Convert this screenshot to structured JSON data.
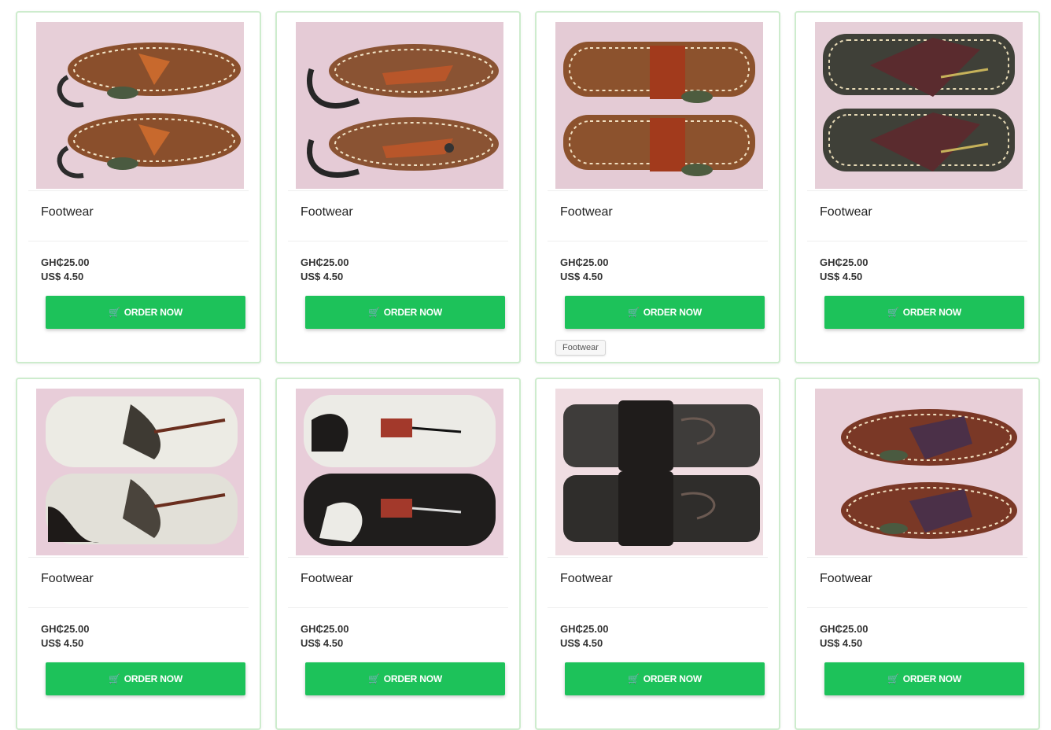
{
  "products": [
    {
      "title": "Footwear",
      "price_ghs": "GH₵25.00",
      "price_usd": "US$ 4.50",
      "button": "ORDER NOW",
      "image": "brown-leather-thong-sandals-with-ankle-strap"
    },
    {
      "title": "Footwear",
      "price_ghs": "GH₵25.00",
      "price_usd": "US$ 4.50",
      "button": "ORDER NOW",
      "image": "brown-leather-sandals-black-ankle-strap-buckle"
    },
    {
      "title": "Footwear",
      "price_ghs": "GH₵25.00",
      "price_usd": "US$ 4.50",
      "button": "ORDER NOW",
      "image": "brown-leather-toe-loop-sandals"
    },
    {
      "title": "Footwear",
      "price_ghs": "GH₵25.00",
      "price_usd": "US$ 4.50",
      "button": "ORDER NOW",
      "image": "dark-leather-flip-flops-gold-stitch"
    },
    {
      "title": "Footwear",
      "price_ghs": "GH₵25.00",
      "price_usd": "US$ 4.50",
      "button": "ORDER NOW",
      "image": "cowhide-fur-flip-flops"
    },
    {
      "title": "Footwear",
      "price_ghs": "GH₵25.00",
      "price_usd": "US$ 4.50",
      "button": "ORDER NOW",
      "image": "cowhide-flip-flops-red-strap"
    },
    {
      "title": "Footwear",
      "price_ghs": "GH₵25.00",
      "price_usd": "US$ 4.50",
      "button": "ORDER NOW",
      "image": "black-leather-toe-ring-slides"
    },
    {
      "title": "Footwear",
      "price_ghs": "GH₵25.00",
      "price_usd": "US$ 4.50",
      "button": "ORDER NOW",
      "image": "brown-leather-flip-flops-purple-strap"
    }
  ],
  "tooltip": {
    "text": "Footwear"
  },
  "icons": {
    "cart": "shopping-cart-icon"
  },
  "colors": {
    "button": "#1dc25a",
    "card_border": "#cdeccd",
    "image_bg": "#e9d3dc"
  }
}
